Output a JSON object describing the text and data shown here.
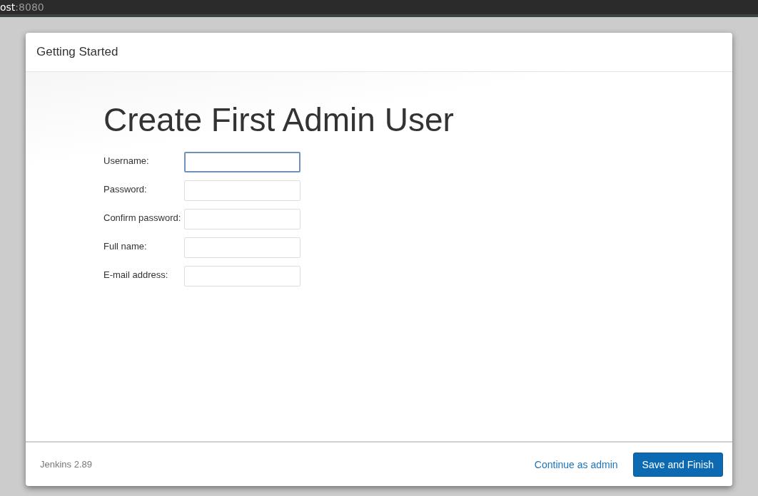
{
  "address_bar": {
    "host": "ost",
    "port": ":8080"
  },
  "dialog": {
    "title": "Getting Started",
    "heading": "Create First Admin User",
    "fields": [
      {
        "label": "Username:",
        "focused": true
      },
      {
        "label": "Password:",
        "focused": false
      },
      {
        "label": "Confirm password:",
        "focused": false
      },
      {
        "label": "Full name:",
        "focused": false
      },
      {
        "label": "E-mail address:",
        "focused": false
      }
    ],
    "version": "Jenkins 2.89",
    "link": "Continue as admin",
    "button": "Save and Finish"
  }
}
